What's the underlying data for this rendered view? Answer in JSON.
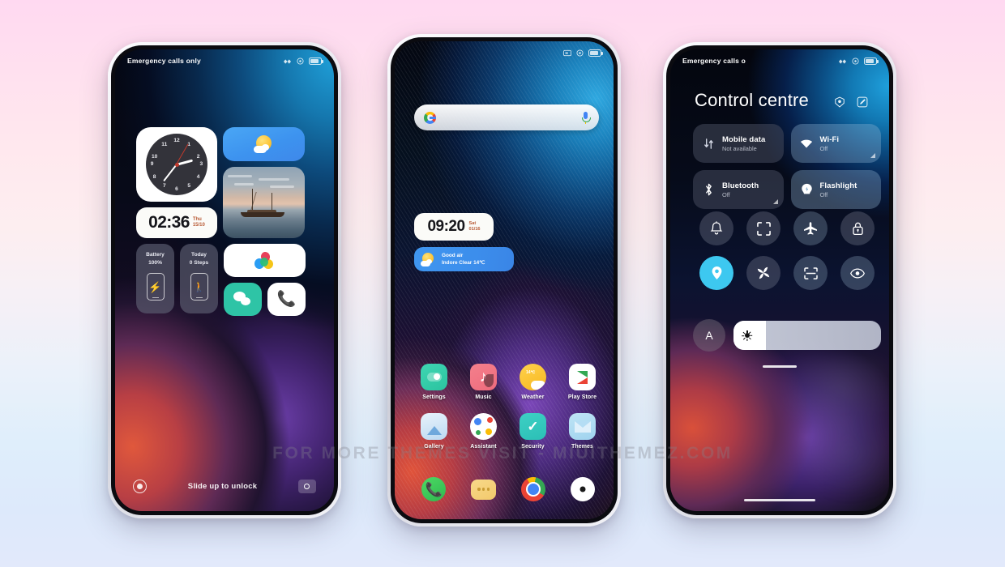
{
  "page": {
    "watermark": "FOR MORE THEMES VISIT - MIUITHEMEZ.COM",
    "bg_top_color": "#ffd9f1",
    "bg_bottom_color": "#dde9fb"
  },
  "lockscreen": {
    "status": {
      "carrier": "Emergency calls only"
    },
    "analog_clock": {
      "numbers": [
        "12",
        "1",
        "2",
        "3",
        "4",
        "5",
        "6",
        "7",
        "8",
        "9",
        "10",
        "11"
      ],
      "hour_deg": 75,
      "minute_deg": 218,
      "second_deg": 30
    },
    "digital": {
      "time": "02:36",
      "day": "Thu",
      "date": "15/10"
    },
    "weather_widget": {
      "icon": "sun-cloud-icon"
    },
    "photo_widget": {
      "icon": "sailboat-photo"
    },
    "battery_tile": {
      "title": "Battery",
      "value": "100%",
      "icon": "phone-charging-icon"
    },
    "steps_tile": {
      "title": "Today",
      "value": "0 Steps",
      "icon": "phone-walking-icon"
    },
    "mi_app": {
      "icon": "mi-cloud-logo-icon"
    },
    "wechat_app": {
      "icon": "wechat-icon"
    },
    "dialer_app": {
      "icon": "phone-call-icon"
    },
    "bottom": {
      "hint": "Slide up to unlock",
      "left_icon": "record-circle-icon",
      "right_icon": "camera-icon"
    }
  },
  "homescreen": {
    "search": {
      "logo": "google-g-icon",
      "mic": "microphone-icon",
      "placeholder": ""
    },
    "clock_widget": {
      "time": "09:20",
      "day": "Sat",
      "date": "01/16"
    },
    "air_widget": {
      "line1": "Good air",
      "line2": "Indore  Clear  14℃",
      "icon": "sun-cloud-icon"
    },
    "apps": [
      {
        "label": "Settings",
        "icon": "settings-icon"
      },
      {
        "label": "Music",
        "icon": "music-note-icon"
      },
      {
        "label": "Weather",
        "icon": "weather-sun-icon"
      },
      {
        "label": "Play Store",
        "icon": "play-store-icon"
      },
      {
        "label": "Gallery",
        "icon": "gallery-icon"
      },
      {
        "label": "Assistant",
        "icon": "google-assistant-icon"
      },
      {
        "label": "Security",
        "icon": "security-shield-icon"
      },
      {
        "label": "Themes",
        "icon": "themes-icon"
      }
    ],
    "dock": [
      {
        "name": "Phone",
        "icon": "phone-icon"
      },
      {
        "name": "Messages",
        "icon": "messages-icon"
      },
      {
        "name": "Chrome",
        "icon": "chrome-icon"
      },
      {
        "name": "Camera",
        "icon": "camera-lens-icon"
      }
    ]
  },
  "control_centre": {
    "status": {
      "carrier": "Emergency calls o"
    },
    "title": "Control centre",
    "actions": [
      {
        "name": "screen-record-icon"
      },
      {
        "name": "edit-icon"
      }
    ],
    "big_tiles": [
      {
        "label": "Mobile data",
        "state": "Not available",
        "icon": "mobile-data-icon",
        "active": false
      },
      {
        "label": "Wi-Fi",
        "state": "Off",
        "icon": "wifi-icon",
        "active": true
      },
      {
        "label": "Bluetooth",
        "state": "Off",
        "icon": "bluetooth-icon",
        "active": false
      },
      {
        "label": "Flashlight",
        "state": "Off",
        "icon": "flashlight-icon",
        "active": true
      }
    ],
    "toggles": [
      {
        "name": "silent-bell-icon",
        "active": false
      },
      {
        "name": "screenshot-icon",
        "active": false
      },
      {
        "name": "airplane-mode-icon",
        "active": false
      },
      {
        "name": "screen-lock-icon",
        "active": false
      },
      {
        "name": "location-icon",
        "active": true
      },
      {
        "name": "sync-fan-icon",
        "active": false
      },
      {
        "name": "scanner-icon",
        "active": false
      },
      {
        "name": "reading-mode-eye-icon",
        "active": false
      }
    ],
    "brightness": {
      "auto_label": "A",
      "icon": "brightness-sun-icon",
      "value_percent": 22
    }
  }
}
